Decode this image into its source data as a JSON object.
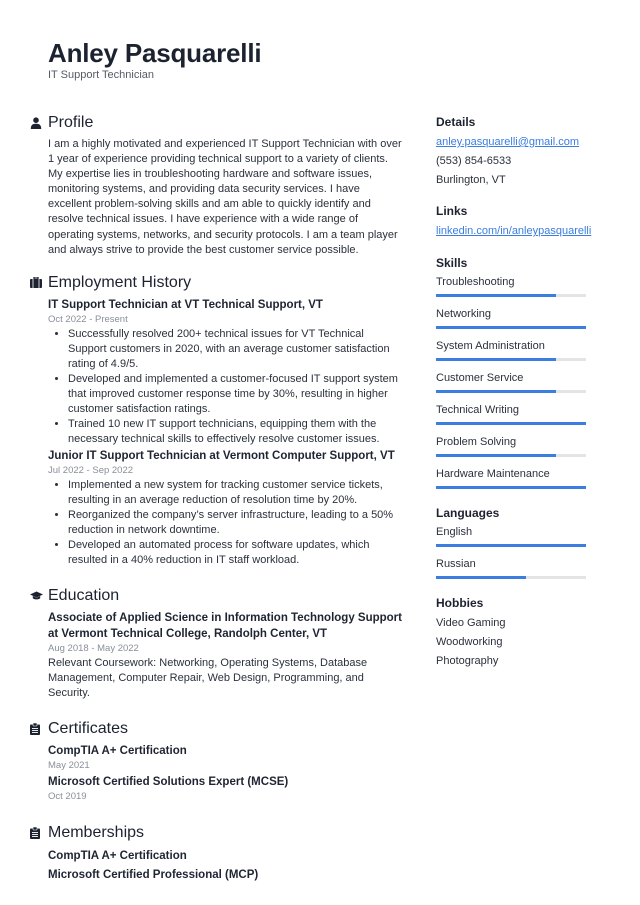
{
  "header": {
    "name": "Anley Pasquarelli",
    "title": "IT Support Technician"
  },
  "profile": {
    "heading": "Profile",
    "icon": "person-icon",
    "text": "I am a highly motivated and experienced IT Support Technician with over 1 year of experience providing technical support to a variety of clients. My expertise lies in troubleshooting hardware and software issues, monitoring systems, and providing data security services. I have excellent problem-solving skills and am able to quickly identify and resolve technical issues. I have experience with a wide range of operating systems, networks, and security protocols. I am a team player and always strive to provide the best customer service possible."
  },
  "employment": {
    "heading": "Employment History",
    "icon": "briefcase-icon",
    "jobs": [
      {
        "title": "IT Support Technician at VT Technical Support, VT",
        "dates": "Oct 2022 - Present",
        "bullets": [
          "Successfully resolved 200+ technical issues for VT Technical Support customers in 2020, with an average customer satisfaction rating of 4.9/5.",
          "Developed and implemented a customer-focused IT support system that improved customer response time by 30%, resulting in higher customer satisfaction ratings.",
          "Trained 10 new IT support technicians, equipping them with the necessary technical skills to effectively resolve customer issues."
        ]
      },
      {
        "title": "Junior IT Support Technician at Vermont Computer Support, VT",
        "dates": "Jul 2022 - Sep 2022",
        "bullets": [
          "Implemented a new system for tracking customer service tickets, resulting in an average reduction of resolution time by 20%.",
          "Reorganized the company’s server infrastructure, leading to a 50% reduction in network downtime.",
          "Developed an automated process for software updates, which resulted in a 40% reduction in IT staff workload."
        ]
      }
    ]
  },
  "education": {
    "heading": "Education",
    "icon": "graduation-cap-icon",
    "degree": "Associate of Applied Science in Information Technology Support at Vermont Technical College, Randolph Center, VT",
    "dates": "Aug 2018 - May 2022",
    "description": "Relevant Coursework: Networking, Operating Systems, Database Management, Computer Repair, Web Design, Programming, and Security."
  },
  "certificates": {
    "heading": "Certificates",
    "icon": "clipboard-icon",
    "items": [
      {
        "name": "CompTIA A+ Certification",
        "date": "May 2021"
      },
      {
        "name": "Microsoft Certified Solutions Expert (MCSE)",
        "date": "Oct 2019"
      }
    ]
  },
  "memberships": {
    "heading": "Memberships",
    "icon": "clipboard-icon",
    "items": [
      {
        "name": "CompTIA A+ Certification"
      },
      {
        "name": "Microsoft Certified Professional (MCP)"
      }
    ]
  },
  "details": {
    "heading": "Details",
    "email": "anley.pasquarelli@gmail.com",
    "phone": "(553) 854-6533",
    "location": "Burlington, VT"
  },
  "links": {
    "heading": "Links",
    "linkedin": "linkedin.com/in/anleypasquarelli"
  },
  "skills": {
    "heading": "Skills",
    "items": [
      {
        "label": "Troubleshooting",
        "level": 0.8
      },
      {
        "label": "Networking",
        "level": 1.0
      },
      {
        "label": "System Administration",
        "level": 0.8
      },
      {
        "label": "Customer Service",
        "level": 0.8
      },
      {
        "label": "Technical Writing",
        "level": 1.0
      },
      {
        "label": "Problem Solving",
        "level": 0.8
      },
      {
        "label": "Hardware Maintenance",
        "level": 1.0
      }
    ]
  },
  "languages": {
    "heading": "Languages",
    "items": [
      {
        "label": "English",
        "level": 1.0
      },
      {
        "label": "Russian",
        "level": 0.6
      }
    ]
  },
  "hobbies": {
    "heading": "Hobbies",
    "items": [
      "Video Gaming",
      "Woodworking",
      "Photography"
    ]
  },
  "colors": {
    "accent": "#3b7de0",
    "track": "#e3e4e6",
    "text": "#1c2230",
    "muted": "#8a8f98"
  }
}
